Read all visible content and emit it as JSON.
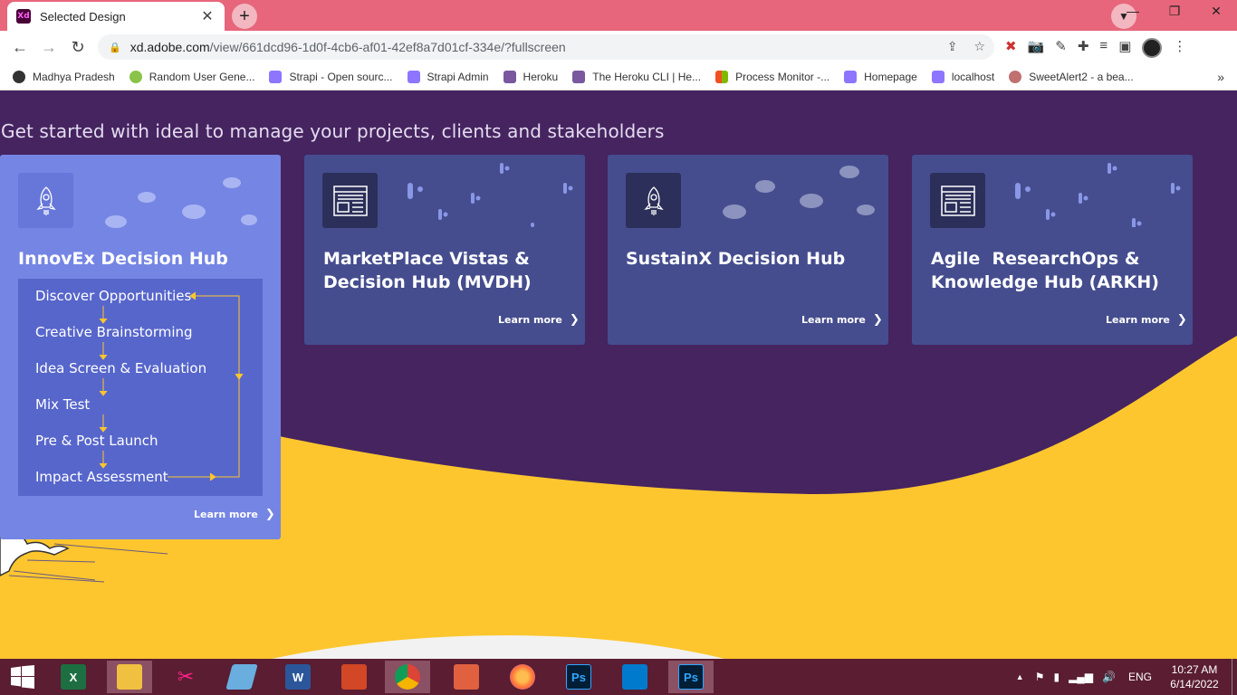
{
  "browser": {
    "tab": {
      "title": "Selected Design",
      "close": "✕",
      "favicon_text": "Xd"
    },
    "new_tab": "+",
    "window_buttons": [
      "—",
      "❐",
      "✕"
    ],
    "url": {
      "host": "xd.adobe.com",
      "path": "/view/661dcd96-1d0f-4cb6-af01-42ef8a7d01cf-334e/?fullscreen"
    },
    "bookmarks": [
      {
        "label": "Madhya Pradesh",
        "color": "#333333"
      },
      {
        "label": "Random User Gene...",
        "color": "#8bc34a"
      },
      {
        "label": "Strapi - Open sourc...",
        "color": "#8e75ff"
      },
      {
        "label": "Strapi Admin",
        "color": "#8e75ff"
      },
      {
        "label": "Heroku",
        "color": "#79589f"
      },
      {
        "label": "The Heroku CLI | He...",
        "color": "#79589f"
      },
      {
        "label": "Process Monitor -...",
        "color": "#f25022"
      },
      {
        "label": "Homepage",
        "color": "#8e75ff"
      },
      {
        "label": "localhost",
        "color": "#8e75ff"
      },
      {
        "label": "SweetAlert2 - a bea...",
        "color": "#c07070"
      }
    ],
    "bookmarks_more": "»"
  },
  "page": {
    "headline": "Get started with ideal to manage your projects, clients and stakeholders",
    "cards": [
      {
        "title_lines": [
          "InnovEx Decision Hub"
        ],
        "icon": "rocket-icon",
        "learn_more": "Learn more",
        "steps": [
          "Discover Opportunities",
          "Creative Brainstorming",
          "Idea Screen & Evaluation",
          "Mix Test",
          "Pre & Post Launch",
          "Impact Assessment"
        ]
      },
      {
        "title_lines": [
          "MarketPlace Vistas &",
          "Decision Hub (MVDH)"
        ],
        "icon": "layout-icon",
        "learn_more": "Learn more"
      },
      {
        "title_lines": [
          "SustainX Decision Hub"
        ],
        "icon": "rocket-icon",
        "learn_more": "Learn more"
      },
      {
        "title_lines": [
          "Agile  ResearchOps &",
          "Knowledge Hub (ARKH)"
        ],
        "icon": "layout-icon",
        "learn_more": "Learn more"
      }
    ]
  },
  "taskbar": {
    "apps": [
      {
        "name": "start",
        "label": ""
      },
      {
        "name": "excel",
        "label": "X",
        "color": "#1d6f42"
      },
      {
        "name": "file-explorer",
        "label": "",
        "color": "#f0c040"
      },
      {
        "name": "snipping-tool",
        "label": "✂",
        "color": "#b04050"
      },
      {
        "name": "notepad",
        "label": "",
        "color": "#6aaee0"
      },
      {
        "name": "word",
        "label": "W",
        "color": "#2b579a"
      },
      {
        "name": "powerpoint",
        "label": "",
        "color": "#d24726"
      },
      {
        "name": "chrome",
        "label": "",
        "color": "#4285f4"
      },
      {
        "name": "reader",
        "label": "",
        "color": "#e06040"
      },
      {
        "name": "firefox",
        "label": "",
        "color": "#ff7139"
      },
      {
        "name": "photoshop",
        "label": "Ps",
        "color": "#001e36"
      },
      {
        "name": "vscode",
        "label": "",
        "color": "#007acc"
      },
      {
        "name": "photoshop-2",
        "label": "Ps",
        "color": "#001e36"
      }
    ],
    "tray": {
      "lang": "ENG",
      "time": "10:27 AM",
      "date": "6/14/2022"
    }
  }
}
